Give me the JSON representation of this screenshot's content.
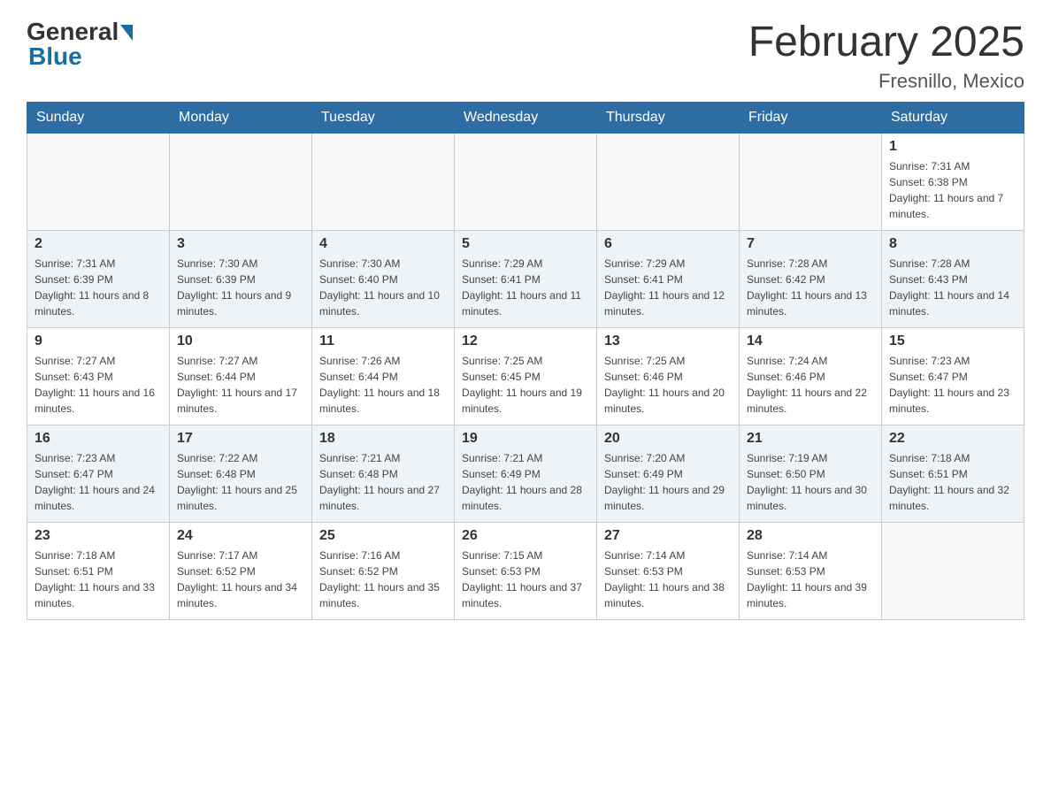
{
  "header": {
    "logo_general": "General",
    "logo_blue": "Blue",
    "month_title": "February 2025",
    "location": "Fresnillo, Mexico"
  },
  "days_of_week": [
    "Sunday",
    "Monday",
    "Tuesday",
    "Wednesday",
    "Thursday",
    "Friday",
    "Saturday"
  ],
  "weeks": [
    [
      {
        "day": "",
        "info": ""
      },
      {
        "day": "",
        "info": ""
      },
      {
        "day": "",
        "info": ""
      },
      {
        "day": "",
        "info": ""
      },
      {
        "day": "",
        "info": ""
      },
      {
        "day": "",
        "info": ""
      },
      {
        "day": "1",
        "info": "Sunrise: 7:31 AM\nSunset: 6:38 PM\nDaylight: 11 hours and 7 minutes."
      }
    ],
    [
      {
        "day": "2",
        "info": "Sunrise: 7:31 AM\nSunset: 6:39 PM\nDaylight: 11 hours and 8 minutes."
      },
      {
        "day": "3",
        "info": "Sunrise: 7:30 AM\nSunset: 6:39 PM\nDaylight: 11 hours and 9 minutes."
      },
      {
        "day": "4",
        "info": "Sunrise: 7:30 AM\nSunset: 6:40 PM\nDaylight: 11 hours and 10 minutes."
      },
      {
        "day": "5",
        "info": "Sunrise: 7:29 AM\nSunset: 6:41 PM\nDaylight: 11 hours and 11 minutes."
      },
      {
        "day": "6",
        "info": "Sunrise: 7:29 AM\nSunset: 6:41 PM\nDaylight: 11 hours and 12 minutes."
      },
      {
        "day": "7",
        "info": "Sunrise: 7:28 AM\nSunset: 6:42 PM\nDaylight: 11 hours and 13 minutes."
      },
      {
        "day": "8",
        "info": "Sunrise: 7:28 AM\nSunset: 6:43 PM\nDaylight: 11 hours and 14 minutes."
      }
    ],
    [
      {
        "day": "9",
        "info": "Sunrise: 7:27 AM\nSunset: 6:43 PM\nDaylight: 11 hours and 16 minutes."
      },
      {
        "day": "10",
        "info": "Sunrise: 7:27 AM\nSunset: 6:44 PM\nDaylight: 11 hours and 17 minutes."
      },
      {
        "day": "11",
        "info": "Sunrise: 7:26 AM\nSunset: 6:44 PM\nDaylight: 11 hours and 18 minutes."
      },
      {
        "day": "12",
        "info": "Sunrise: 7:25 AM\nSunset: 6:45 PM\nDaylight: 11 hours and 19 minutes."
      },
      {
        "day": "13",
        "info": "Sunrise: 7:25 AM\nSunset: 6:46 PM\nDaylight: 11 hours and 20 minutes."
      },
      {
        "day": "14",
        "info": "Sunrise: 7:24 AM\nSunset: 6:46 PM\nDaylight: 11 hours and 22 minutes."
      },
      {
        "day": "15",
        "info": "Sunrise: 7:23 AM\nSunset: 6:47 PM\nDaylight: 11 hours and 23 minutes."
      }
    ],
    [
      {
        "day": "16",
        "info": "Sunrise: 7:23 AM\nSunset: 6:47 PM\nDaylight: 11 hours and 24 minutes."
      },
      {
        "day": "17",
        "info": "Sunrise: 7:22 AM\nSunset: 6:48 PM\nDaylight: 11 hours and 25 minutes."
      },
      {
        "day": "18",
        "info": "Sunrise: 7:21 AM\nSunset: 6:48 PM\nDaylight: 11 hours and 27 minutes."
      },
      {
        "day": "19",
        "info": "Sunrise: 7:21 AM\nSunset: 6:49 PM\nDaylight: 11 hours and 28 minutes."
      },
      {
        "day": "20",
        "info": "Sunrise: 7:20 AM\nSunset: 6:49 PM\nDaylight: 11 hours and 29 minutes."
      },
      {
        "day": "21",
        "info": "Sunrise: 7:19 AM\nSunset: 6:50 PM\nDaylight: 11 hours and 30 minutes."
      },
      {
        "day": "22",
        "info": "Sunrise: 7:18 AM\nSunset: 6:51 PM\nDaylight: 11 hours and 32 minutes."
      }
    ],
    [
      {
        "day": "23",
        "info": "Sunrise: 7:18 AM\nSunset: 6:51 PM\nDaylight: 11 hours and 33 minutes."
      },
      {
        "day": "24",
        "info": "Sunrise: 7:17 AM\nSunset: 6:52 PM\nDaylight: 11 hours and 34 minutes."
      },
      {
        "day": "25",
        "info": "Sunrise: 7:16 AM\nSunset: 6:52 PM\nDaylight: 11 hours and 35 minutes."
      },
      {
        "day": "26",
        "info": "Sunrise: 7:15 AM\nSunset: 6:53 PM\nDaylight: 11 hours and 37 minutes."
      },
      {
        "day": "27",
        "info": "Sunrise: 7:14 AM\nSunset: 6:53 PM\nDaylight: 11 hours and 38 minutes."
      },
      {
        "day": "28",
        "info": "Sunrise: 7:14 AM\nSunset: 6:53 PM\nDaylight: 11 hours and 39 minutes."
      },
      {
        "day": "",
        "info": ""
      }
    ]
  ]
}
